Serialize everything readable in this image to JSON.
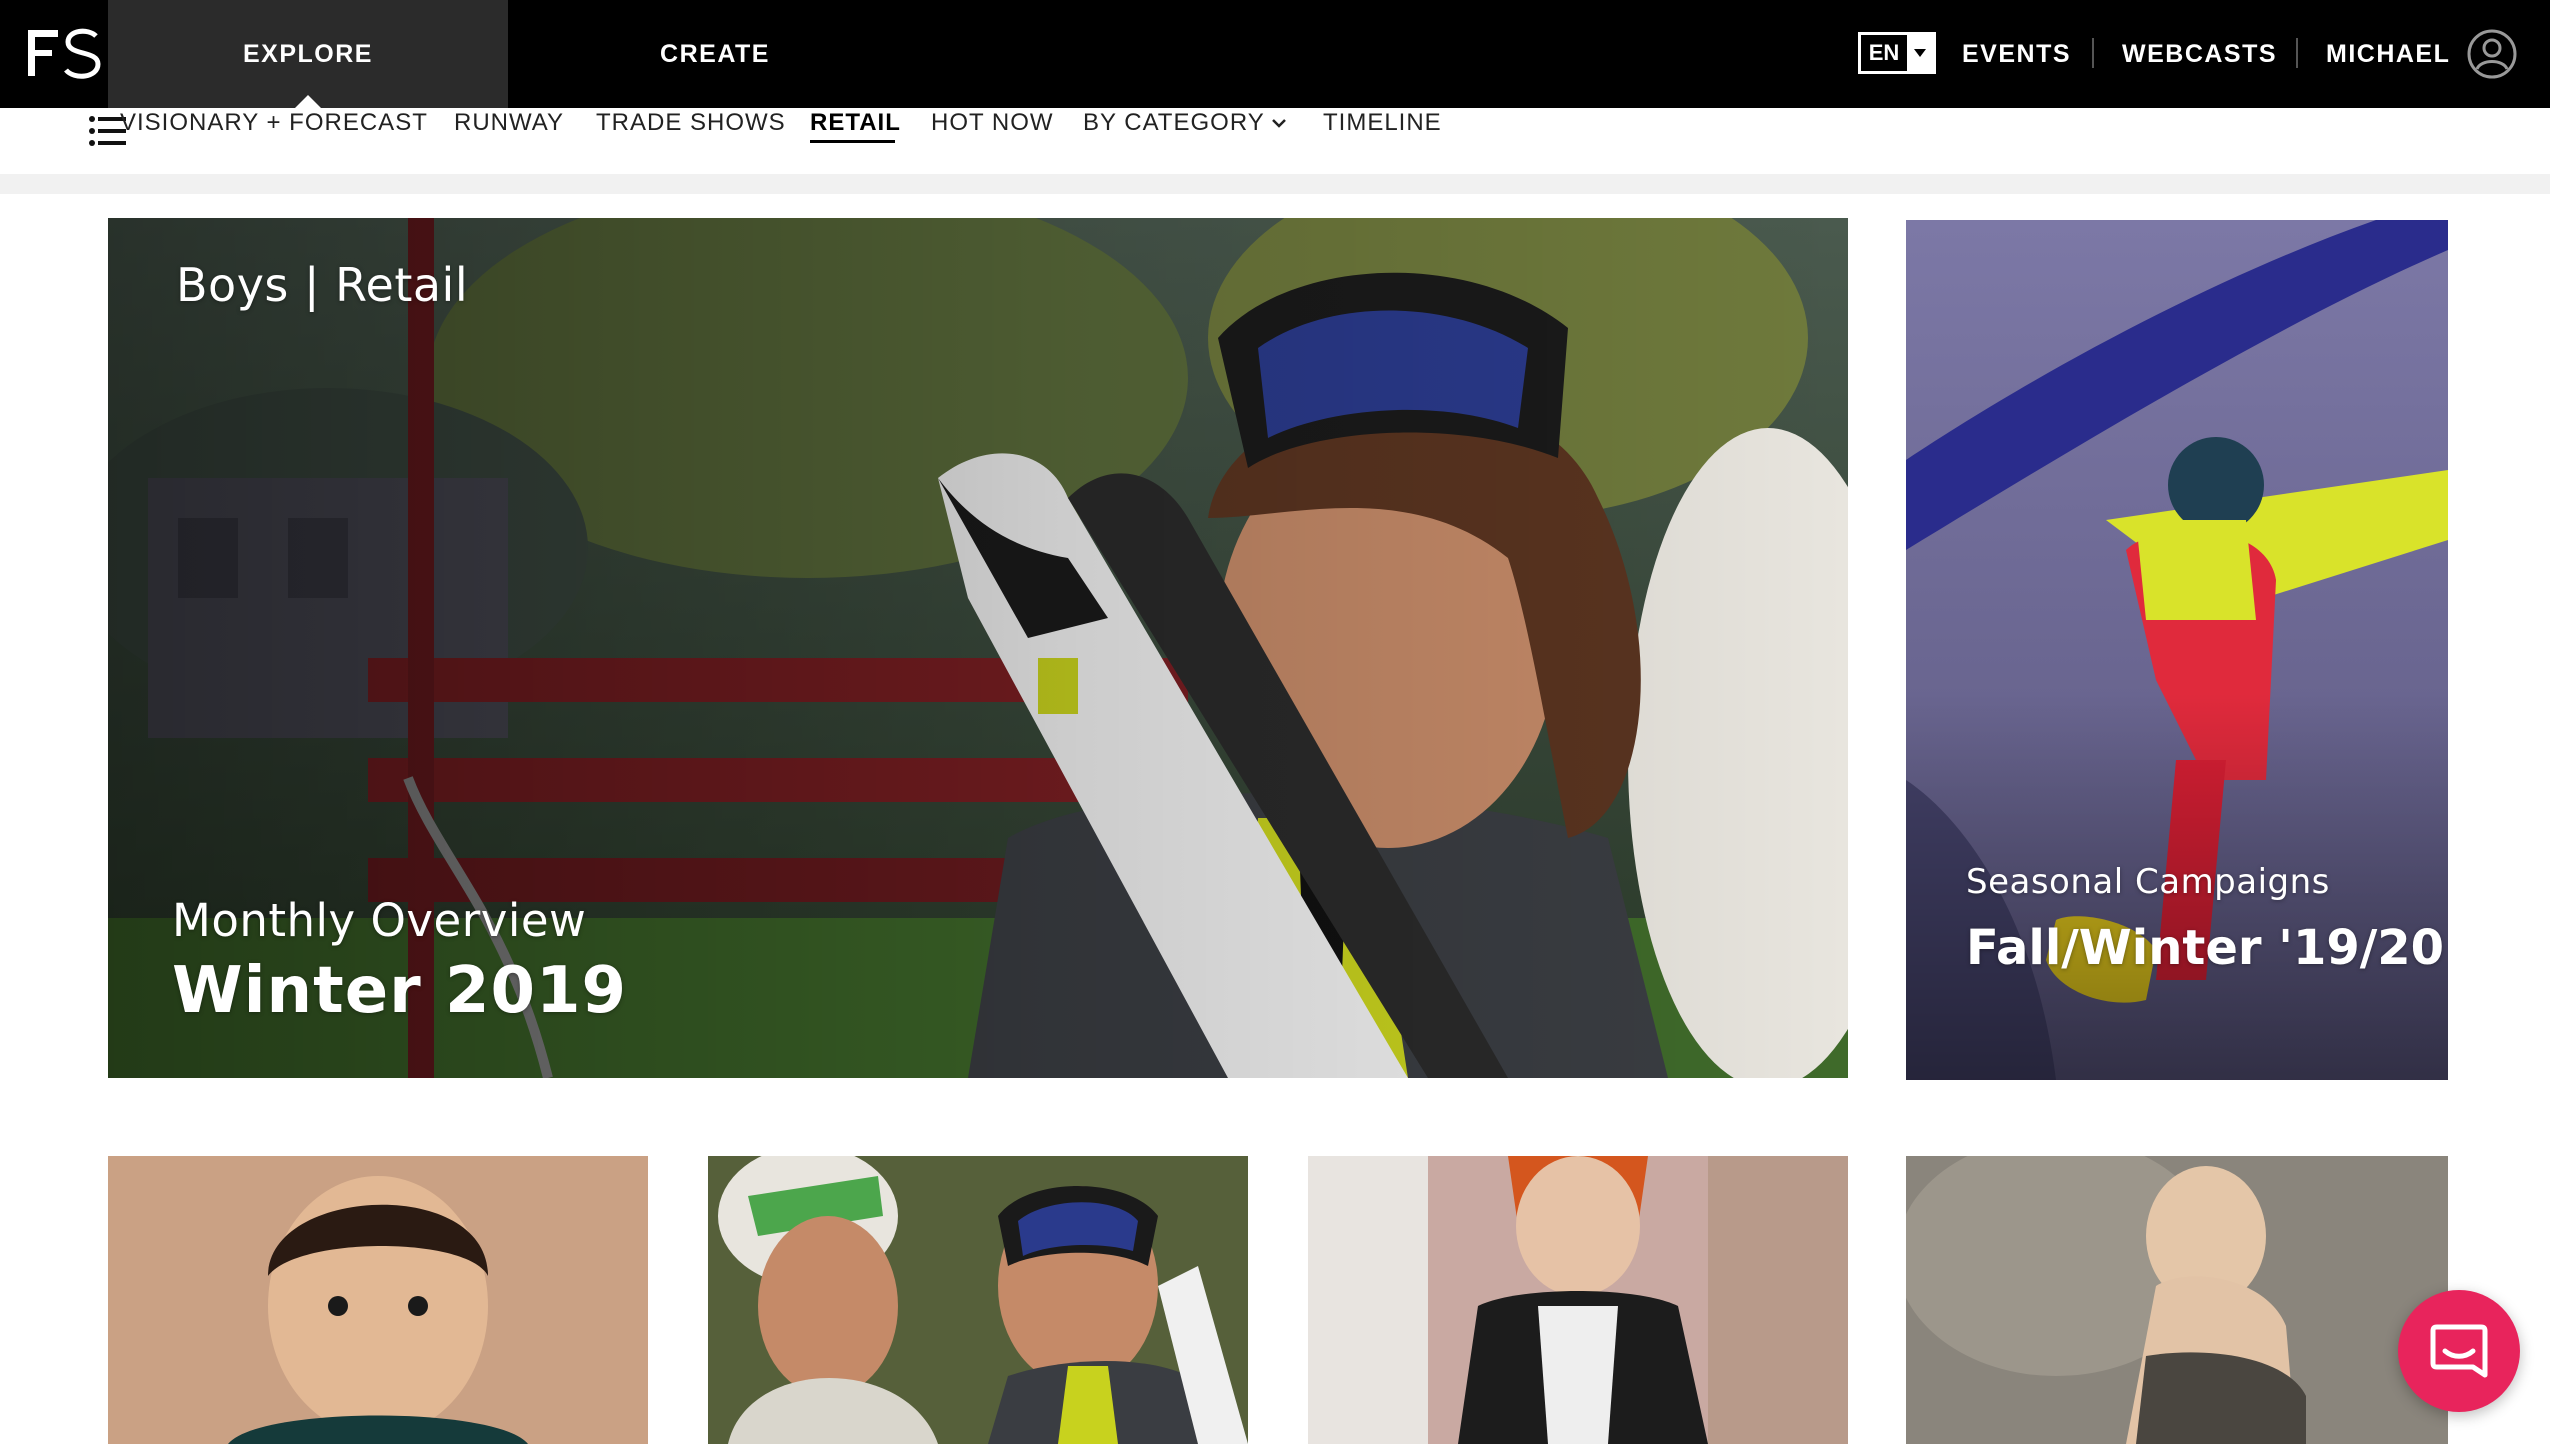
{
  "header": {
    "logo_text": "FS",
    "tabs": [
      {
        "label": "EXPLORE",
        "active": true
      },
      {
        "label": "CREATE",
        "active": false
      }
    ],
    "language": {
      "selected": "EN"
    },
    "links": [
      {
        "label": "EVENTS"
      },
      {
        "label": "WEBCASTS"
      },
      {
        "label": "MICHAEL"
      }
    ],
    "user_icon": "user-circle-icon"
  },
  "subnav": {
    "menu_icon": "hamburger-list-icon",
    "items": [
      {
        "label": "VISIONARY + FORECAST"
      },
      {
        "label": "RUNWAY"
      },
      {
        "label": "TRADE SHOWS"
      },
      {
        "label": "RETAIL",
        "active": true
      },
      {
        "label": "HOT NOW"
      },
      {
        "label": "BY CATEGORY",
        "has_dropdown": true
      },
      {
        "label": "TIMELINE"
      }
    ],
    "dropdown_icon": "chevron-down-icon"
  },
  "hero": {
    "tag": "Boys | Retail",
    "subtitle": "Monthly Overview",
    "title": "Winter 2019"
  },
  "side_card": {
    "subtitle": "Seasonal Campaigns",
    "title": "Fall/Winter '19/20"
  },
  "thumbnails": [
    {
      "image": "toddler-portrait"
    },
    {
      "image": "kids-with-skis"
    },
    {
      "image": "boy-red-hair-jacket"
    },
    {
      "image": "baby-crawling"
    }
  ],
  "chat": {
    "icon": "chat-bubble-icon"
  },
  "colors": {
    "topbar_bg": "#000000",
    "explore_tab_bg": "#2b2b2b",
    "chat_button": "#e8245c",
    "side_card_accent": "#d9e32a"
  }
}
